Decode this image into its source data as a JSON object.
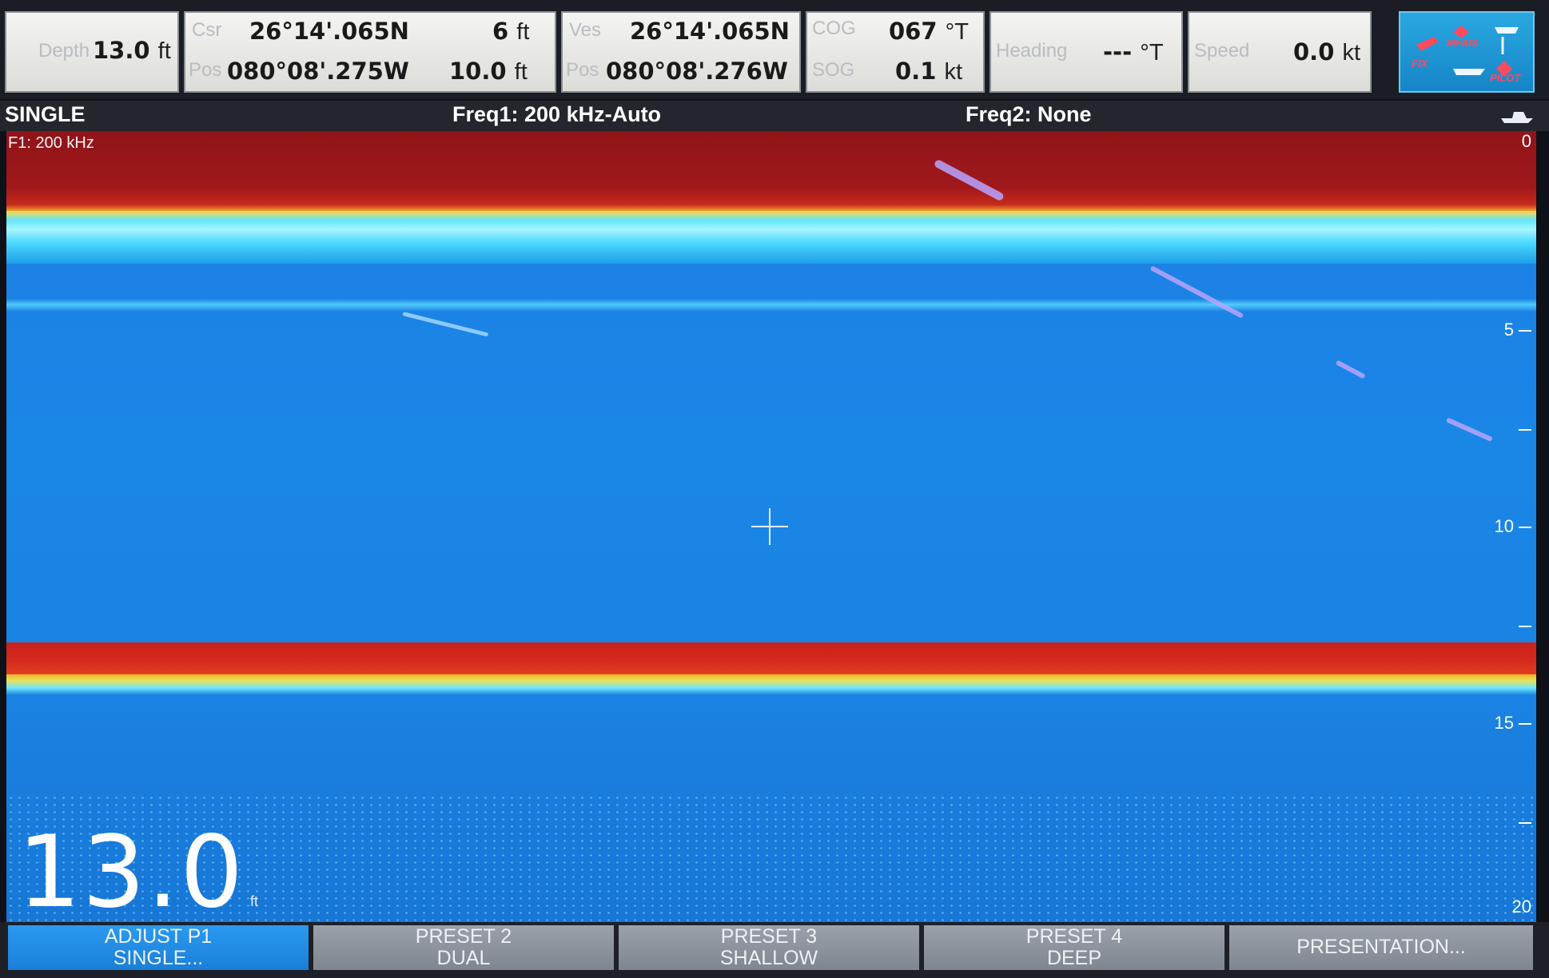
{
  "databar": {
    "depth": {
      "label": "Depth",
      "value": "13.0",
      "unit": "ft"
    },
    "cursor": {
      "csr_label": "Csr",
      "csr_lat": "26°14'.065N",
      "csr_depth": "6",
      "csr_depth_unit": "ft",
      "pos_label": "Pos",
      "pos_lon": "080°08'.275W",
      "pos_range": "10.0",
      "pos_range_unit": "ft"
    },
    "vessel": {
      "ves_label": "Ves",
      "lat": "26°14'.065N",
      "pos_label": "Pos",
      "lon": "080°08'.276W"
    },
    "cog_sog": {
      "cog_label": "COG",
      "cog_value": "067",
      "cog_unit": "°T",
      "sog_label": "SOG",
      "sog_value": "0.1",
      "sog_unit": "kt"
    },
    "heading": {
      "label": "Heading",
      "value": "---",
      "unit": "°T"
    },
    "speed": {
      "label": "Speed",
      "value": "0.0",
      "unit": "kt"
    },
    "mode_icons": [
      "FIX",
      "MFAIS",
      "PILOT"
    ]
  },
  "mode_strip": {
    "mode": "SINGLE",
    "freq1": "Freq1: 200 kHz-Auto",
    "freq2": "Freq2: None"
  },
  "sonar": {
    "channel_label": "F1: 200 kHz",
    "depth_scale": [
      "0",
      "5",
      "10",
      "15",
      "20"
    ],
    "current_depth": "13.0",
    "current_depth_unit": "ft",
    "colors": {
      "surface": "#a0181b",
      "water": "#1a86e6",
      "bottom": "#d62a1d"
    }
  },
  "softkeys": [
    {
      "line1": "ADJUST P1",
      "line2": "SINGLE..."
    },
    {
      "line1": "PRESET 2",
      "line2": "DUAL"
    },
    {
      "line1": "PRESET 3",
      "line2": "SHALLOW"
    },
    {
      "line1": "PRESET 4",
      "line2": "DEEP"
    },
    {
      "line1": "PRESENTATION...",
      "line2": ""
    }
  ]
}
